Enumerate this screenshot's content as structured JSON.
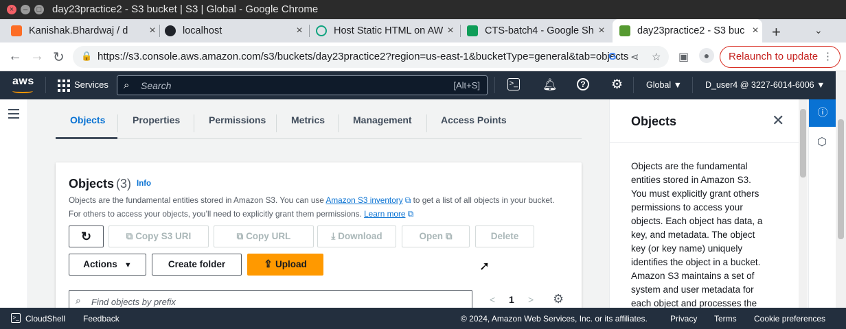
{
  "window": {
    "title": "day23practice2 - S3 bucket | S3 | Global - Google Chrome"
  },
  "browser_tabs": [
    {
      "label": "Kanishak.Bhardwaj / d",
      "icon": "gitlab-icon"
    },
    {
      "label": "localhost",
      "icon": "react-icon"
    },
    {
      "label": "Host Static HTML on AW",
      "icon": "chatgpt-icon"
    },
    {
      "label": "CTS-batch4 - Google Sh",
      "icon": "sheets-icon"
    },
    {
      "label": "day23practice2 - S3 buc",
      "icon": "s3-icon"
    }
  ],
  "toolbar": {
    "url": "https://s3.console.aws.amazon.com/s3/buckets/day23practice2?region=us-east-1&bucketType=general&tab=objects",
    "relaunch_label": "Relaunch to update"
  },
  "aws_nav": {
    "logo": "aws",
    "services": "Services",
    "search_placeholder": "Search",
    "search_shortcut": "[Alt+S]",
    "region": "Global ▼",
    "account": "D_user4 @ 3227-6014-6006 ▼"
  },
  "s3_tabs": [
    "Objects",
    "Properties",
    "Permissions",
    "Metrics",
    "Management",
    "Access Points"
  ],
  "objects_panel": {
    "title": "Objects",
    "count": "(3)",
    "info": "Info",
    "desc_part1": "Objects are the fundamental entities stored in Amazon S3. You can use ",
    "desc_link1": "Amazon S3 inventory",
    "desc_part2": " to get a list of all objects in your bucket. For others to access your objects, you’ll need to explicitly grant them permissions. ",
    "desc_link2": "Learn more",
    "buttons": {
      "copy_s3_uri": "Copy S3 URI",
      "copy_url": "Copy URL",
      "download": "Download",
      "open": "Open",
      "delete": "Delete",
      "actions": "Actions",
      "create_folder": "Create folder",
      "upload": "Upload"
    },
    "find_placeholder": "Find objects by prefix",
    "page": "1"
  },
  "help_panel": {
    "title": "Objects",
    "body": "Objects are the fundamental entities stored in Amazon S3. You must explicitly grant others permissions to access your objects. Each object has data, a key, and metadata. The object key (or key name) uniquely identifies the object in a bucket. Amazon S3 maintains a set of system and user metadata for each object and processes the"
  },
  "footer": {
    "cloudshell": "CloudShell",
    "feedback": "Feedback",
    "copyright": "© 2024, Amazon Web Services, Inc. or its affiliates.",
    "privacy": "Privacy",
    "terms": "Terms",
    "cookies": "Cookie preferences"
  },
  "colors": {
    "aws_nav": "#232f3e",
    "link": "#0972d3",
    "upload": "#ff9900"
  }
}
